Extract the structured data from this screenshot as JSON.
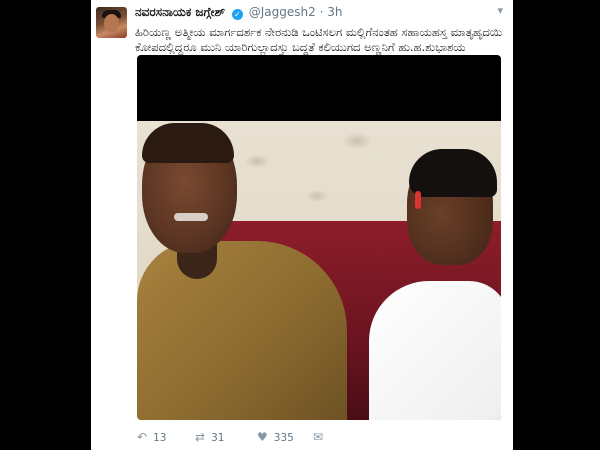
{
  "tweet": {
    "display_name": "ನವರಸನಾಯಕ ಜಗ್ಗೇಶ್",
    "handle": "@Jaggesh2",
    "time": "3h",
    "text": "ಹಿರಿಯಣ್ಣ ಅತ್ಮೀಯ ಮಾರ್ಗದರ್ಶಕ ನೇರನುಡಿ ಒಂಟಿಸಲಗ ಮಲ್ಲಿಗೆನಂತಹ ಸಹಾಯಹಸ್ತ ಮಾತೃಹೃದಯಿ ಕೋಪದಲ್ಲಿದ್ದರೂ ಮುನಿ ಯಾರಿಗುಲ್ಲಾದಸ್ತು ಬದ್ಧತೆ ಕಲಿಯುಗದ ಅಣ್ಣನಿಗೆ ಹು.ಹ.ಶುಭಾಶಯ"
  },
  "actions": {
    "reply_count": "13",
    "retweet_count": "31",
    "like_count": "335"
  },
  "icons": {
    "verified": "verified-badge-icon",
    "caret": "chevron-down-icon",
    "reply": "reply-icon",
    "retweet": "retweet-icon",
    "like": "heart-icon",
    "dm": "direct-message-icon"
  },
  "colors": {
    "accent": "#1da1f2",
    "background": "#000000",
    "card": "#ffffff"
  }
}
